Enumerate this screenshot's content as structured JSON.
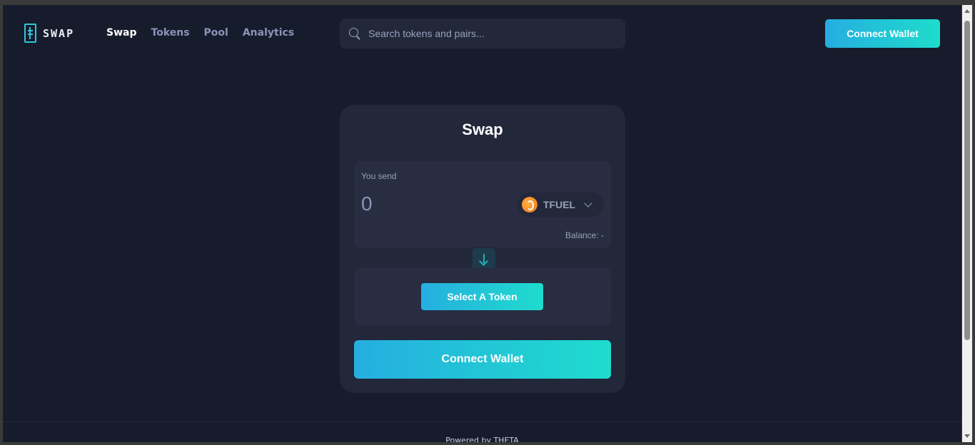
{
  "header": {
    "logo_text": "SWAP",
    "nav": [
      {
        "label": "Swap",
        "active": true
      },
      {
        "label": "Tokens",
        "active": false
      },
      {
        "label": "Pool",
        "active": false
      },
      {
        "label": "Analytics",
        "active": false
      }
    ],
    "search_placeholder": "Search tokens and pairs...",
    "connect_label": "Connect Wallet"
  },
  "card": {
    "title": "Swap",
    "send": {
      "label": "You send",
      "amount": "0",
      "token": "TFUEL",
      "token_icon": "tfuel-icon",
      "balance": "Balance: -"
    },
    "receive": {
      "select_label": "Select A Token"
    },
    "connect_label": "Connect Wallet"
  },
  "footer": {
    "text": "Powered by THETA"
  },
  "colors": {
    "background": "#171c2c",
    "card": "#22273a",
    "accent_start": "#25aee0",
    "accent_end": "#1fdccd"
  }
}
